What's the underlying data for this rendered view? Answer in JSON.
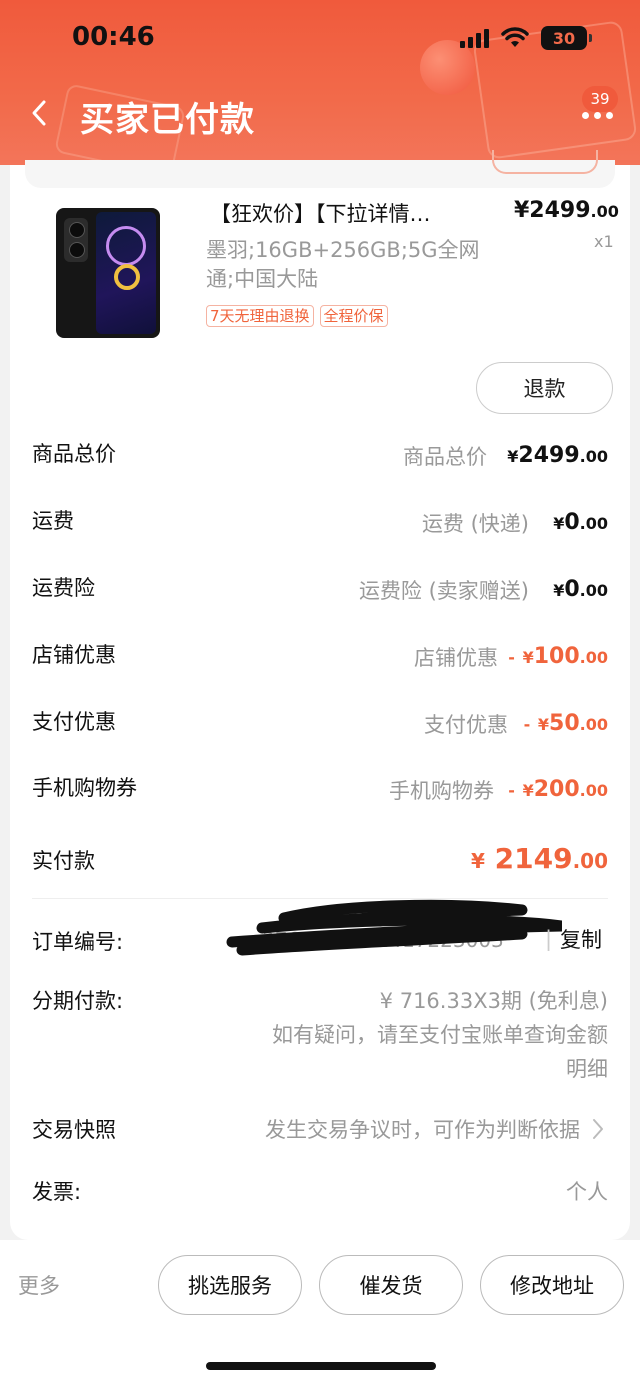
{
  "status_bar": {
    "time": "00:46",
    "battery": "30"
  },
  "header": {
    "title": "买家已付款",
    "notification_count": "39"
  },
  "product": {
    "title": "【狂欢价】【下拉详情…",
    "price_int": "¥2499",
    "price_dec": ".00",
    "quantity": "x1",
    "spec": "墨羽;16GB+256GB;5G全网通;中国大陆",
    "tags": [
      "7天无理由退换",
      "全程价保"
    ],
    "refund_button": "退款"
  },
  "price_rows": [
    {
      "label": "商品总价",
      "desc": "商品总价",
      "sign": "",
      "currency": "¥",
      "int": "2499",
      "dec": ".00"
    },
    {
      "label": "运费",
      "desc": "运费 (快递)",
      "sign": "",
      "currency": "¥",
      "int": "0",
      "dec": ".00"
    },
    {
      "label": "运费险",
      "desc": "运费险 (卖家赠送)",
      "sign": "",
      "currency": "¥",
      "int": "0",
      "dec": ".00"
    },
    {
      "label": "店铺优惠",
      "desc": "店铺优惠",
      "sign": "-",
      "currency": "¥",
      "int": "100",
      "dec": ".00"
    },
    {
      "label": "支付优惠",
      "desc": "支付优惠",
      "sign": "-",
      "currency": "¥",
      "int": "50",
      "dec": ".00"
    },
    {
      "label": "手机购物券",
      "desc": "手机购物券",
      "sign": "-",
      "currency": "¥",
      "int": "200",
      "dec": ".00"
    }
  ],
  "payment": {
    "label": "实付款",
    "currency": "¥",
    "int": "2149",
    "dec": ".00"
  },
  "order": {
    "number_label": "订单编号:",
    "number_value": "3762889002417223003",
    "copy_label": "复制",
    "installment_label": "分期付款:",
    "installment_lines": [
      "¥ 716.33X3期 (免利息)",
      "如有疑问，请至支付宝账单查询金额",
      "明细"
    ],
    "snapshot_label": "交易快照",
    "snapshot_desc": "发生交易争议时，可作为判断依据",
    "invoice_label": "发票:",
    "invoice_value": "个人"
  },
  "bottom_bar": {
    "more": "更多",
    "buttons": [
      "挑选服务",
      "催发货",
      "修改地址"
    ]
  },
  "colors": {
    "header": "#f26a4a",
    "accent": "#f0643c"
  }
}
